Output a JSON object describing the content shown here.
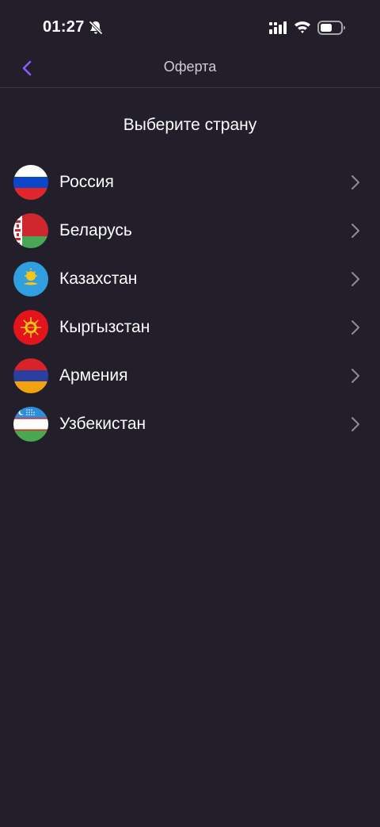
{
  "status_bar": {
    "time": "01:27",
    "icons": [
      "bell-slash-icon",
      "cellular-signal-icon",
      "wifi-icon",
      "battery-icon"
    ]
  },
  "nav": {
    "title": "Оферта",
    "back_icon": "chevron-left-icon",
    "accent_color": "#8b5cf6"
  },
  "heading": "Выберите страну",
  "countries": [
    {
      "name": "Россия",
      "flag": "flag-russia-icon"
    },
    {
      "name": "Беларусь",
      "flag": "flag-belarus-icon"
    },
    {
      "name": "Казахстан",
      "flag": "flag-kazakhstan-icon"
    },
    {
      "name": "Кыргызстан",
      "flag": "flag-kyrgyzstan-icon"
    },
    {
      "name": "Армения",
      "flag": "flag-armenia-icon"
    },
    {
      "name": "Узбекистан",
      "flag": "flag-uzbekistan-icon"
    }
  ],
  "colors": {
    "background": "#221f2a",
    "text": "#ffffff",
    "chevron": "#8e8a96"
  }
}
